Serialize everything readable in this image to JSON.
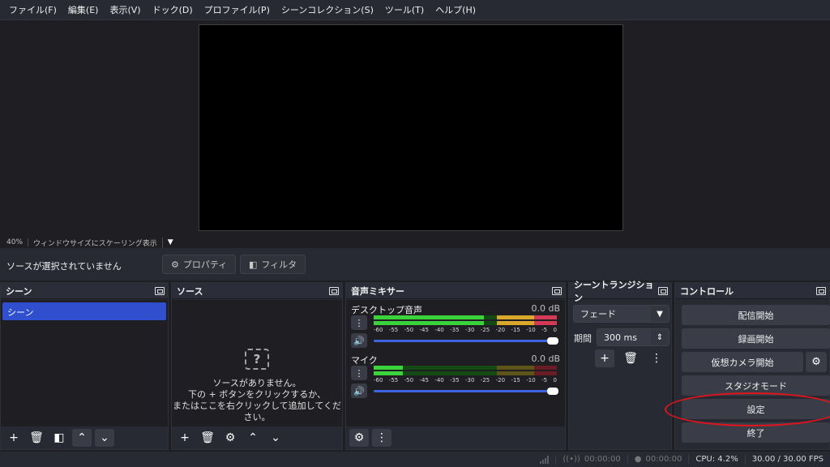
{
  "menu": [
    "ファイル(F)",
    "編集(E)",
    "表示(V)",
    "ドック(D)",
    "プロファイル(P)",
    "シーンコレクション(S)",
    "ツール(T)",
    "ヘルプ(H)"
  ],
  "zoom": {
    "level": "40%",
    "mode": "ウィンドウサイズにスケーリング表示"
  },
  "source_toolbar": {
    "no_source": "ソースが選択されていません",
    "properties": "プロパティ",
    "filters": "フィルタ"
  },
  "docks": {
    "scenes": {
      "title": "シーン",
      "items": [
        "シーン"
      ]
    },
    "sources": {
      "title": "ソース",
      "empty_line1": "ソースがありません。",
      "empty_line2": "下の + ボタンをクリックするか、",
      "empty_line3": "またはここを右クリックして追加してください。"
    },
    "mixer": {
      "title": "音声ミキサー",
      "channels": [
        {
          "name": "デスクトップ音声",
          "db": "0.0 dB",
          "level": 0.6
        },
        {
          "name": "マイク",
          "db": "0.0 dB",
          "level": 0.16
        }
      ],
      "ticks": [
        "-60",
        "-55",
        "-50",
        "-45",
        "-40",
        "-35",
        "-30",
        "-25",
        "-20",
        "-15",
        "-10",
        "-5",
        "0"
      ]
    },
    "transitions": {
      "title": "シーントランジション",
      "type": "フェード",
      "duration_label": "期間",
      "duration": "300 ms"
    },
    "controls": {
      "title": "コントロール",
      "buttons": [
        "配信開始",
        "録画開始",
        "仮想カメラ開始",
        "スタジオモード",
        "設定",
        "終了"
      ]
    }
  },
  "status": {
    "stream_time": "00:00:00",
    "rec_time": "00:00:00",
    "cpu": "CPU: 4.2%",
    "fps": "30.00 / 30.00 FPS"
  },
  "colors": {
    "accent": "#2f4fce",
    "annotation": "#e0141c"
  }
}
